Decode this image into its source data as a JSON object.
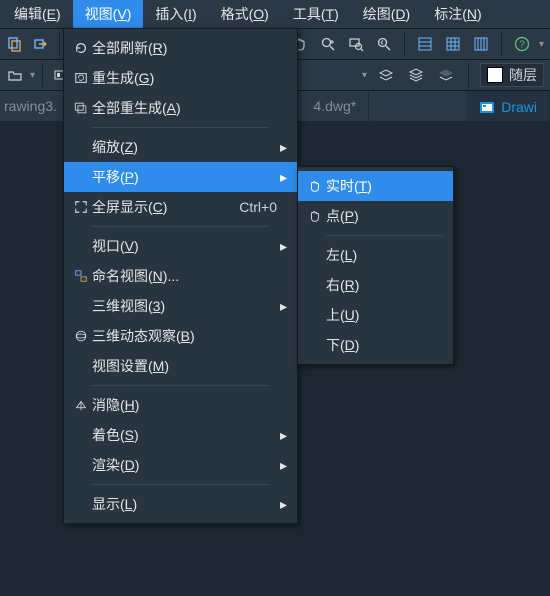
{
  "menubar": {
    "items": [
      {
        "label": "编辑(E)"
      },
      {
        "label": "视图(V)",
        "active": true
      },
      {
        "label": "插入(I)"
      },
      {
        "label": "格式(O)"
      },
      {
        "label": "工具(T)"
      },
      {
        "label": "绘图(D)"
      },
      {
        "label": "标注(N)"
      }
    ]
  },
  "toolbar_right_1": {
    "help": "?"
  },
  "toolbar_right_2": {
    "bylayer": "随层"
  },
  "tabs": {
    "left_partial": "rawing3.",
    "mid_partial": "4.dwg*",
    "active": "Drawi"
  },
  "view_menu": {
    "refresh_all": "全部刷新(R)",
    "regen": "重生成(G)",
    "regen_all": "全部重生成(A)",
    "zoom": "缩放(Z)",
    "pan": "平移(P)",
    "fullscreen": "全屏显示(C)",
    "fullscreen_accel": "Ctrl+0",
    "viewport": "视口(V)",
    "named_views": "命名视图(N)...",
    "view3d": "三维视图(3)",
    "orbit3d": "三维动态观察(B)",
    "view_settings": "视图设置(M)",
    "hide": "消隐(H)",
    "shade": "着色(S)",
    "render": "渲染(D)",
    "display": "显示(L)"
  },
  "pan_submenu": {
    "realtime": "实时(T)",
    "point": "点(P)",
    "left": "左(L)",
    "right": "右(R)",
    "up": "上(U)",
    "down": "下(D)"
  },
  "colors": {
    "accent": "#2f8ceb",
    "panel": "#293441",
    "bg": "#1e2833"
  }
}
